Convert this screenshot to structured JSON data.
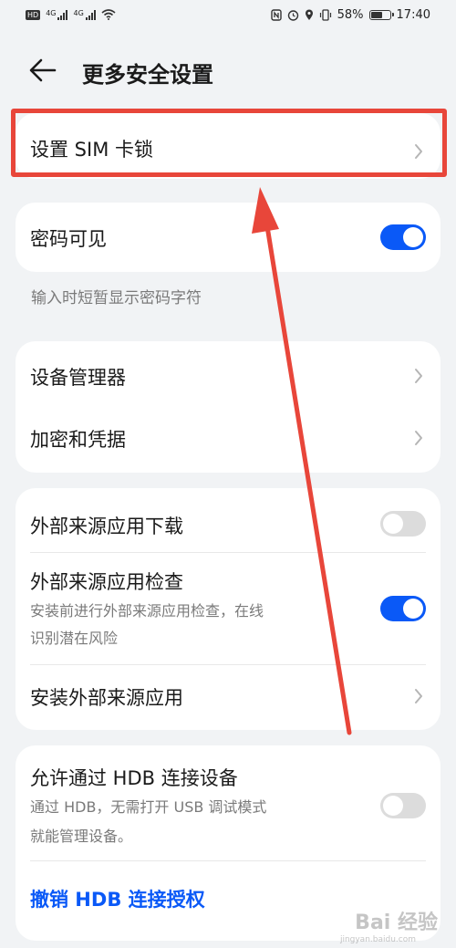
{
  "status_bar": {
    "battery_percent": "58%",
    "time": "17:40",
    "network_1": "4G",
    "network_2": "4G",
    "hd_badge": "HD"
  },
  "header": {
    "title": "更多安全设置"
  },
  "sim_lock": {
    "label": "设置 SIM 卡锁"
  },
  "password_visible": {
    "label": "密码可见",
    "enabled": true,
    "hint": "输入时短暂显示密码字符"
  },
  "device_group": {
    "items": [
      {
        "label": "设备管理器"
      },
      {
        "label": "加密和凭据"
      }
    ]
  },
  "external_sources": {
    "download": {
      "label": "外部来源应用下载",
      "enabled": false
    },
    "check": {
      "label": "外部来源应用检查",
      "description_line1": "安装前进行外部来源应用检查，在线",
      "description_line2": "识别潜在风险",
      "enabled": true
    },
    "install": {
      "label": "安装外部来源应用"
    }
  },
  "hdb": {
    "label": "允许通过 HDB 连接设备",
    "description_line1": "通过 HDB，无需打开 USB 调试模式",
    "description_line2": "就能管理设备。",
    "enabled": false,
    "revoke_label": "撤销 HDB 连接授权"
  },
  "annotation": {
    "color": "#e8463a"
  },
  "watermark": {
    "text": "Bai 经验",
    "sub": "jingyan.baidu.com"
  },
  "colors": {
    "accent": "#0a59f7",
    "background": "#f1f3f5",
    "card": "#ffffff"
  }
}
